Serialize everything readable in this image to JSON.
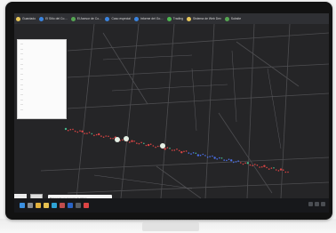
{
  "browser": {
    "bookmarks": [
      {
        "label": "Guardado",
        "icon": "bookmark-icon",
        "color": "#e8c75a"
      },
      {
        "label": "El Sitio del Co…",
        "icon": "site-icon",
        "color": "#3a84e0"
      },
      {
        "label": "El Asesor de Co…",
        "icon": "site-icon",
        "color": "#55a552"
      },
      {
        "label": "Caso especial",
        "icon": "site-icon",
        "color": "#3a84e0"
      },
      {
        "label": "Informe del Go…",
        "icon": "site-icon",
        "color": "#3a84e0"
      },
      {
        "label": "Trading",
        "icon": "site-icon",
        "color": "#4cb64f"
      },
      {
        "label": "Sistema de Web Dev",
        "icon": "site-icon",
        "color": "#e8c75a"
      },
      {
        "label": "Subsite",
        "icon": "site-icon",
        "color": "#55a552"
      }
    ]
  },
  "legend": {
    "rows": [
      "—",
      "—",
      "—",
      "—",
      "—",
      "—",
      "—",
      "—",
      "—",
      "—",
      "—",
      "—",
      "—",
      "—"
    ]
  },
  "search": {
    "placeholder": "Búsqueda en el mapa de Azure"
  },
  "taskbar": {
    "apps": [
      {
        "icon": "windows-start-icon",
        "color": "#3a8fe0"
      },
      {
        "icon": "search-icon",
        "color": "#8a8d92"
      },
      {
        "icon": "chrome-icon",
        "color": "#e2b03c"
      },
      {
        "icon": "file-explorer-icon",
        "color": "#e6c050"
      },
      {
        "icon": "edge-icon",
        "color": "#2fa3d6"
      },
      {
        "icon": "app-icon",
        "color": "#c04d4d"
      },
      {
        "icon": "word-icon",
        "color": "#2a63c4"
      },
      {
        "icon": "app-icon",
        "color": "#5a5d62"
      },
      {
        "icon": "app-icon",
        "color": "#d44"
      }
    ]
  },
  "colors": {
    "track_red": "#d94444",
    "track_blue": "#4a6fe8",
    "track_green": "#47b58a"
  }
}
